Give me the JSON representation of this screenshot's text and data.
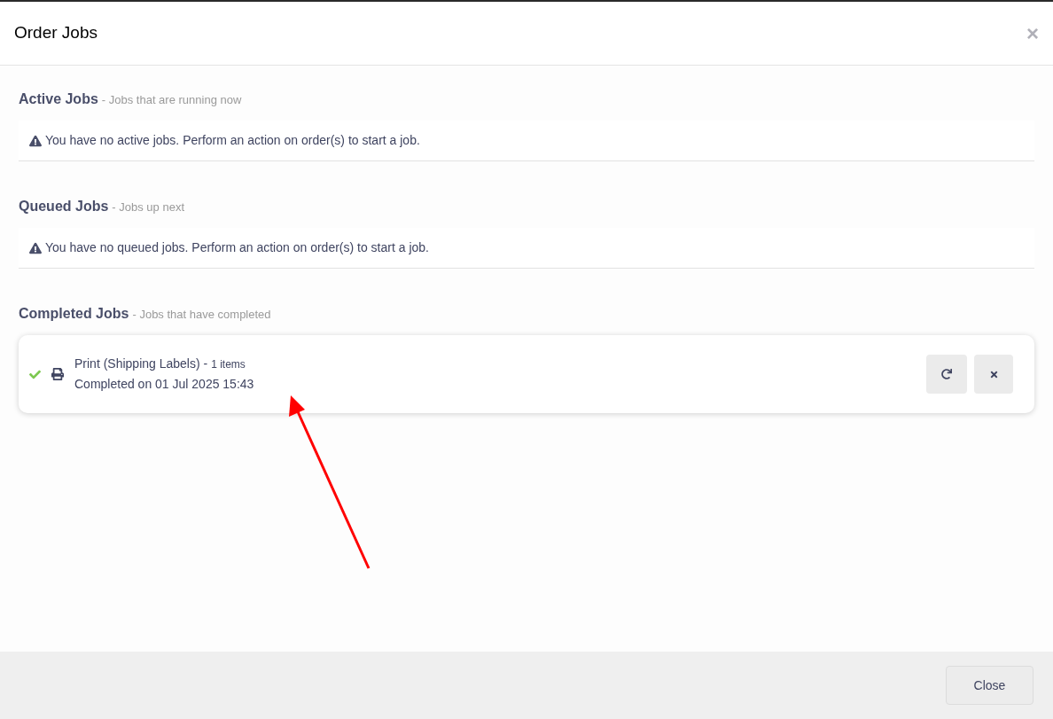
{
  "dialog": {
    "title": "Order Jobs",
    "close_icon": "×"
  },
  "sections": [
    {
      "title": "Active Jobs",
      "subtitle": "- Jobs that are running now",
      "kind": "empty",
      "message": "You have no active jobs. Perform an action on order(s) to start a job."
    },
    {
      "title": "Queued Jobs",
      "subtitle": "- Jobs up next",
      "kind": "empty",
      "message": "You have no queued jobs. Perform an action on order(s) to start a job."
    },
    {
      "title": "Completed Jobs",
      "subtitle": "- Jobs that have completed",
      "kind": "jobs",
      "jobs": [
        {
          "name": "Print (Shipping Labels) -",
          "count": "1 items",
          "detail": "Completed on 01 Jul 2025 15:43",
          "completed": true
        }
      ]
    }
  ],
  "footer": {
    "button": "Close"
  }
}
